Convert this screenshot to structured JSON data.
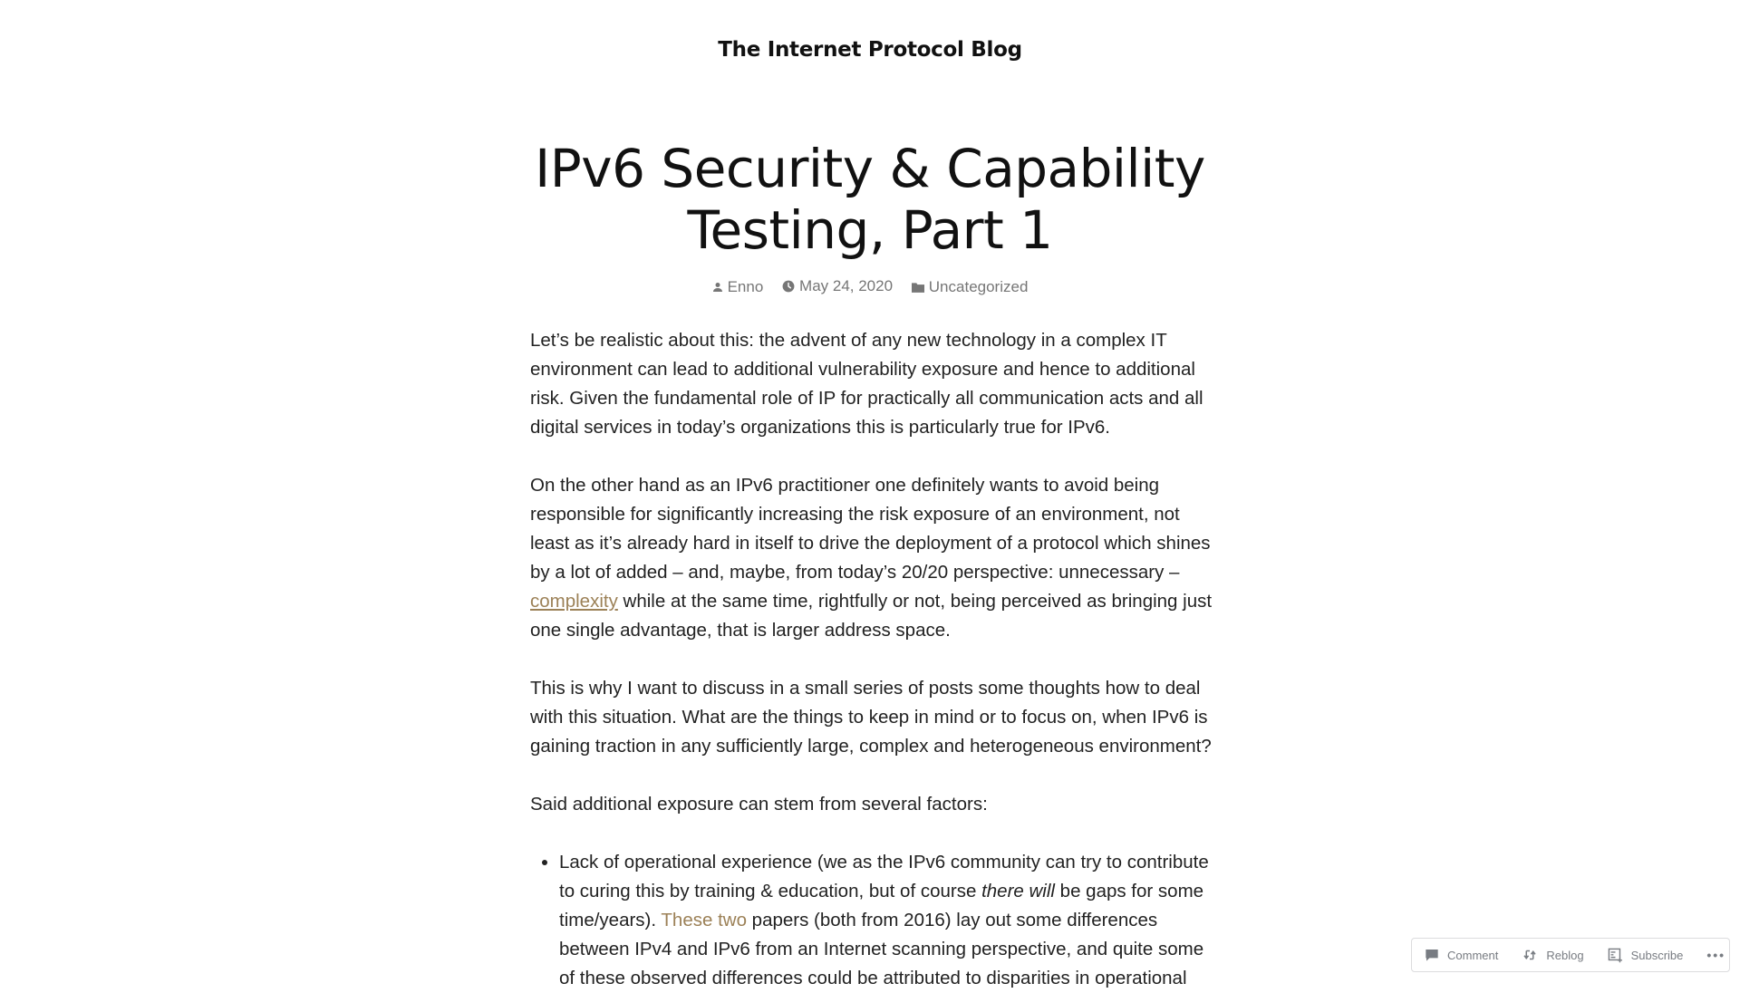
{
  "site": {
    "title": "The Internet Protocol Blog"
  },
  "post": {
    "title": "IPv6 Security & Capability Testing, Part 1",
    "meta": {
      "author_icon": "person-icon",
      "author": "Enno",
      "date_icon": "clock-icon",
      "date": "May 24, 2020",
      "category_icon": "folder-icon",
      "category": "Uncategorized"
    },
    "paragraphs": {
      "p1": "Let’s be realistic about this: the advent of any new technology in a complex IT environment can lead to additional vulnerability exposure and hence to additional risk. Given the fundamental role of IP for practically all communication acts and all digital services in today’s organizations this is particularly true for IPv6.",
      "p2_before_link": "On the other hand as an IPv6 practitioner one definitely wants to avoid being responsible for significantly increasing the risk exposure of an environment, not least as it’s already hard in itself to drive the deployment of a protocol which shines by a lot of added – and, maybe, from today’s 20/20 perspective: unnecessary – ",
      "p2_link": "complexity",
      "p2_after_link": " while at the same time, rightfully or not, being perceived as bringing just one single advantage, that is larger address space.",
      "p3": "This is why I want to discuss in a small series of posts some thoughts how to deal with this situation. What are the things to keep in mind or to focus on, when IPv6 is gaining traction in any sufficiently large, complex and heterogeneous environment?",
      "p4": "Said additional exposure can stem from several factors:"
    },
    "bullets": [
      {
        "before_italic": "Lack of operational experience (we as the IPv6 community can try to contribute to curing this by training & education, but of course ",
        "italic": "there will",
        "after_italic": " be gaps for some time/years). ",
        "link": "These two",
        "after_link": " papers (both from 2016) lay out some differences between IPv4 and IPv6 from an Internet scanning perspective, and quite some of these observed differences could be attributed to disparities in operational"
      }
    ]
  },
  "action_bar": {
    "comment": "Comment",
    "reblog": "Reblog",
    "subscribe": "Subscribe",
    "more": "•••"
  },
  "colors": {
    "link": "#9c8157",
    "text": "#222222",
    "meta": "#767676"
  }
}
